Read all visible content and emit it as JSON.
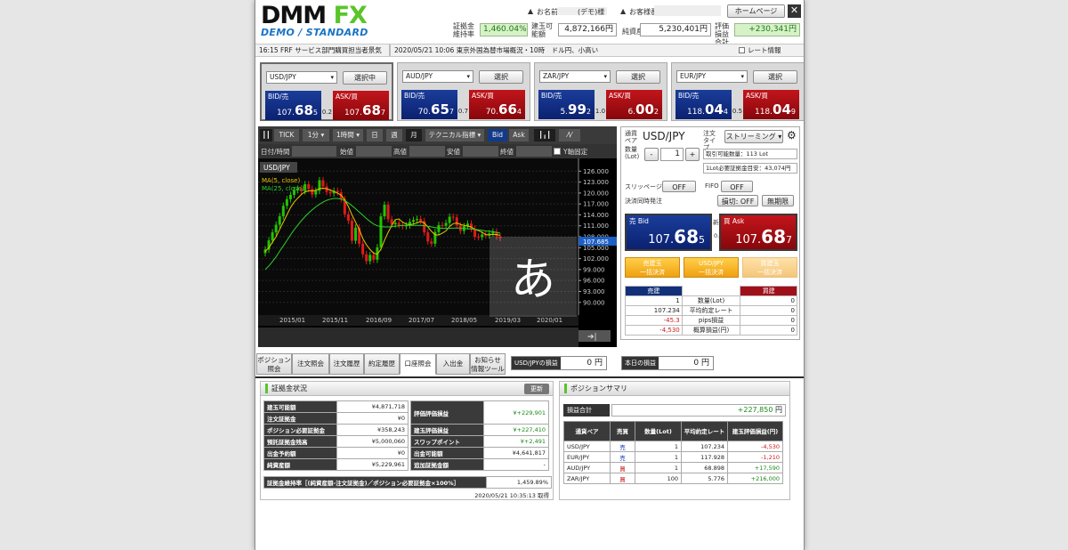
{
  "header": {
    "logo_main": "DMM",
    "logo_fx": "FX",
    "logo_sub": "DEMO / STANDARD",
    "name_label": "お名前",
    "name_value": "(デモ)様",
    "customer_label": "お客様番号",
    "homepage_button": "ホームページ",
    "margin_rate_label": "証拠金維持率",
    "margin_rate_value": "1,460.04%",
    "available_label": "建玉可能額",
    "available_value": "4,872,166円",
    "net_assets_label": "純資産",
    "net_assets_value": "5,230,401円",
    "total_pl_label": "評価損益合計",
    "total_pl_value": "+230,341円"
  },
  "news": {
    "item1": "16:15 FRF サービス部門購買担当者景気",
    "item2": "2020/05/21 10:06 東京外国為替市場概況・10時　ドル円、小高い",
    "rate_info_label": "レート情報"
  },
  "tickers": [
    {
      "pair": "USD/JPY",
      "button": "選択中",
      "bid_label": "BID/売",
      "ask_label": "ASK/買",
      "bid": [
        "107.",
        "68",
        "5"
      ],
      "ask": [
        "107.",
        "68",
        "7"
      ],
      "spread": "0.2"
    },
    {
      "pair": "AUD/JPY",
      "button": "選択",
      "bid_label": "BID/売",
      "ask_label": "ASK/買",
      "bid": [
        "70.",
        "65",
        "7"
      ],
      "ask": [
        "70.",
        "66",
        "4"
      ],
      "spread": "0.7"
    },
    {
      "pair": "ZAR/JPY",
      "button": "選択",
      "bid_label": "BID/売",
      "ask_label": "ASK/買",
      "bid": [
        "5.",
        "99",
        "2"
      ],
      "ask": [
        "6.",
        "00",
        "2"
      ],
      "spread": "1.0"
    },
    {
      "pair": "EUR/JPY",
      "button": "選択",
      "bid_label": "BID/売",
      "ask_label": "ASK/買",
      "bid": [
        "118.",
        "04",
        "4"
      ],
      "ask": [
        "118.",
        "04",
        "9"
      ],
      "spread": "0.5"
    }
  ],
  "chart_toolbar": {
    "tick": "TICK",
    "min": "1分",
    "hour": "1時間",
    "day": "日",
    "week": "週",
    "month": "月",
    "indicator": "テクニカル指標",
    "bid": "Bid",
    "ask": "Ask",
    "datetime_label": "日付/時間",
    "open_label": "始値",
    "high_label": "高値",
    "low_label": "安値",
    "close_label": "終値",
    "yfix_label": "Y軸固定"
  },
  "chart_data": {
    "type": "candlestick",
    "pair": "USD/JPY",
    "legend": [
      "MA(5, close)",
      "MA(25, close)"
    ],
    "y_ticks": [
      "126.000",
      "123.000",
      "120.000",
      "117.000",
      "114.000",
      "111.000",
      "108.000",
      "105.000",
      "102.000",
      "99.000",
      "96.000",
      "93.000",
      "90.000"
    ],
    "ylim": [
      87.5,
      129
    ],
    "current_price": "107.685",
    "x_ticks": [
      "2015/01",
      "2015/11",
      "2016/09",
      "2017/07",
      "2018/05",
      "2019/03",
      "2020/01"
    ],
    "candles_close": [
      104.5,
      107,
      109.2,
      111.3,
      113.6,
      116.5,
      118.3,
      119.5,
      120.8,
      121.2,
      120.5,
      122.4,
      121.1,
      119.6,
      120.6,
      123.5,
      121.8,
      120.3,
      119.9,
      120.6,
      120.2,
      118.3,
      114.2,
      112.4,
      106.9,
      110.5,
      106.1,
      103.2,
      101.3,
      103.0,
      101.7,
      105.1,
      113.6,
      116.8,
      112.8,
      111.4,
      111.8,
      111.2,
      110.9,
      111.1,
      112.1,
      112.6,
      112.9,
      112.3,
      109.2,
      106.7,
      106.1,
      109.3,
      111.2,
      111.0,
      111.8,
      113.5,
      113.3,
      111.1,
      109.6,
      110.9,
      111.6,
      110.2,
      108.0,
      107.9,
      108.6,
      108.4,
      108.9,
      109.4,
      108.1,
      107.7
    ],
    "ma5": [
      104,
      105,
      106.5,
      108,
      110,
      112,
      114,
      116,
      117.5,
      118.6,
      119.6,
      120.3,
      120.6,
      120.6,
      120.7,
      121.2,
      121.3,
      121.2,
      120.8,
      120.4,
      120,
      119.4,
      118.1,
      116.3,
      114,
      112,
      110,
      107.5,
      105.8,
      104.5,
      103.5,
      103.2,
      104.6,
      107,
      109.2,
      111.1,
      112.7,
      112.9,
      112,
      111.5,
      111.3,
      111.5,
      111.8,
      112.2,
      111.8,
      110.7,
      109.5,
      108.5,
      108.5,
      109,
      109.6,
      110.8,
      111.6,
      111.8,
      111.4,
      111.1,
      110.9,
      110.7,
      110,
      109.7,
      109.2,
      108.6,
      108.5,
      108.7,
      108.6,
      108.4
    ],
    "ma25": [
      99,
      100,
      101.2,
      102.5,
      104,
      105.5,
      107,
      108.5,
      109.9,
      111.2,
      112.4,
      113.5,
      114.5,
      115.4,
      116.2,
      116.9,
      117.5,
      118,
      118.3,
      118.5,
      118.5,
      118.3,
      117.9,
      117.3,
      116.5,
      115.7,
      114.8,
      113.9,
      113,
      112.2,
      111.5,
      111,
      110.8,
      110.7,
      110.7,
      110.8,
      110.9,
      111,
      111.1,
      111.1,
      111.1,
      111.1,
      111.1,
      111.1,
      111,
      110.9,
      110.7,
      110.5,
      110.4,
      110.3,
      110.3,
      110.3,
      110.4,
      110.4,
      110.4,
      110.3,
      110.2,
      110.1,
      110,
      109.9,
      109.8,
      109.6,
      109.5,
      109.4,
      109.2,
      109
    ]
  },
  "ime_glyph": "あ",
  "order": {
    "pair_label": "通貨ペア",
    "pair": "USD/JPY",
    "type_label": "注文タイプ",
    "type_value": "ストリーミング",
    "qty_label": "数量(Lot)",
    "qty_value": "1",
    "minus": "-",
    "plus": "+",
    "max_lot": "取引可能数量：113 Lot",
    "margin_lot": "1Lot必要証拠金目安：43,074円",
    "slippage_label": "スリッページ",
    "slippage_value": "OFF",
    "fifo_label": "FIFO",
    "fifo_value": "OFF",
    "settle_label": "決済同時発注",
    "settle_value": "損切: OFF",
    "settle_btn2": "無期限",
    "bid_label": "売 Bid",
    "ask_label": "買 Ask",
    "new_label": "新規",
    "spread": "0.2",
    "bid": [
      "107.",
      "68",
      "5"
    ],
    "ask": [
      "107.",
      "68",
      "7"
    ],
    "btn_sell_close": [
      "売建玉",
      "一括決済"
    ],
    "btn_pair_close": [
      "USD/JPY",
      "一括決済"
    ],
    "btn_buy_close": [
      "買建玉",
      "一括決済"
    ],
    "tbl_sell": "売建",
    "tbl_buy": "買建",
    "rows": [
      {
        "sell": "1",
        "label": "数量(Lot)",
        "buy": "0"
      },
      {
        "sell": "107.234",
        "label": "平均約定レート",
        "buy": "0"
      },
      {
        "sell": "-45.3",
        "label": "pips損益",
        "buy": "0"
      },
      {
        "sell": "-4,530",
        "label": "概算損益(円)",
        "buy": "0"
      }
    ]
  },
  "tabs": [
    [
      "ポジション",
      "照会"
    ],
    [
      "注文照会"
    ],
    [
      "注文履歴"
    ],
    [
      "約定履歴"
    ],
    [
      "口座照会"
    ],
    [
      "入出金"
    ],
    [
      "お知らせ",
      "情報ツール"
    ]
  ],
  "summary_pl": {
    "pair_pl_label": "USD/JPYの損益",
    "pair_pl_value": "0 円",
    "today_pl_label": "本日の損益",
    "today_pl_value": "0 円"
  },
  "margin": {
    "title": "証拠金状況",
    "refresh": "更新",
    "left": [
      {
        "k": "建玉可能額",
        "v": "¥4,871,718"
      },
      {
        "k": "注文証拠金",
        "v": "¥0"
      },
      {
        "k": "ポジション必要証拠金",
        "v": "¥358,243"
      },
      {
        "k": "預託証拠金残高",
        "v": "¥5,000,060"
      },
      {
        "k": "出金予約額",
        "v": "¥0"
      },
      {
        "k": "純資産額",
        "v": "¥5,229,961"
      }
    ],
    "right": [
      {
        "k": "評価評価損益",
        "v": "¥+229,901"
      },
      {
        "k": "建玉評価損益",
        "v": "¥+227,410"
      },
      {
        "k": "スワップポイント",
        "v": "¥+2,491"
      },
      {
        "k": "出金可能額",
        "v": "¥4,641,817"
      },
      {
        "k": "追加証拠金額",
        "v": "-"
      }
    ],
    "ratio_label": "証拠金維持率［(純資産額-注文証拠金)／ポジション必要証拠金×100%］",
    "ratio_value": "1,459.89%",
    "timestamp": "2020/05/21 10:35:13 取得"
  },
  "position_summary": {
    "title": "ポジションサマリ",
    "total_label": "損益合計",
    "total_value": "+227,850",
    "total_unit": "円",
    "headers": [
      "通貨ペア",
      "売買",
      "数量(Lot)",
      "平均約定レート",
      "建玉評価損益(円)"
    ],
    "rows": [
      {
        "pair": "USD/JPY",
        "side": "売",
        "qty": "1",
        "rate": "107.234",
        "pl": "-4,530"
      },
      {
        "pair": "EUR/JPY",
        "side": "売",
        "qty": "1",
        "rate": "117.928",
        "pl": "-1,210"
      },
      {
        "pair": "AUD/JPY",
        "side": "買",
        "qty": "1",
        "rate": "68.898",
        "pl": "+17,590"
      },
      {
        "pair": "ZAR/JPY",
        "side": "買",
        "qty": "100",
        "rate": "5.776",
        "pl": "+216,000"
      }
    ]
  }
}
